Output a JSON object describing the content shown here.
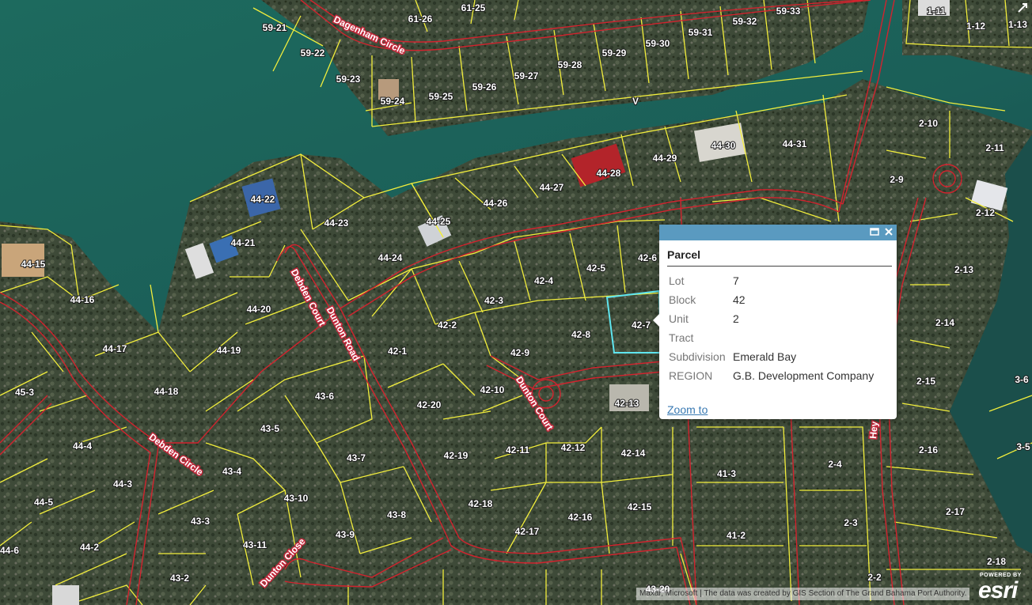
{
  "map": {
    "lots": [
      {
        "id": "61-25"
      },
      {
        "id": "61-26"
      },
      {
        "id": "59-21"
      },
      {
        "id": "59-22"
      },
      {
        "id": "59-23"
      },
      {
        "id": "59-24"
      },
      {
        "id": "59-25"
      },
      {
        "id": "59-26"
      },
      {
        "id": "59-27"
      },
      {
        "id": "59-28"
      },
      {
        "id": "59-29"
      },
      {
        "id": "59-30"
      },
      {
        "id": "59-31"
      },
      {
        "id": "59-32"
      },
      {
        "id": "59-33"
      },
      {
        "id": "1-11"
      },
      {
        "id": "1-12"
      },
      {
        "id": "1-13"
      },
      {
        "id": "44-30"
      },
      {
        "id": "44-31"
      },
      {
        "id": "44-29"
      },
      {
        "id": "44-28"
      },
      {
        "id": "44-27"
      },
      {
        "id": "44-26"
      },
      {
        "id": "44-25"
      },
      {
        "id": "44-24"
      },
      {
        "id": "44-23"
      },
      {
        "id": "44-22"
      },
      {
        "id": "44-21"
      },
      {
        "id": "44-20"
      },
      {
        "id": "44-19"
      },
      {
        "id": "44-18"
      },
      {
        "id": "44-17"
      },
      {
        "id": "44-16"
      },
      {
        "id": "44-15"
      },
      {
        "id": "44-4"
      },
      {
        "id": "44-3"
      },
      {
        "id": "44-5"
      },
      {
        "id": "44-2"
      },
      {
        "id": "44-6"
      },
      {
        "id": "45-3"
      },
      {
        "id": "2-10"
      },
      {
        "id": "2-11"
      },
      {
        "id": "2-9"
      },
      {
        "id": "2-12"
      },
      {
        "id": "2-13"
      },
      {
        "id": "2-14"
      },
      {
        "id": "2-15"
      },
      {
        "id": "2-16"
      },
      {
        "id": "2-4"
      },
      {
        "id": "2-3"
      },
      {
        "id": "2-17"
      },
      {
        "id": "2-18"
      },
      {
        "id": "2-2"
      },
      {
        "id": "3-6"
      },
      {
        "id": "3-5"
      },
      {
        "id": "42-6"
      },
      {
        "id": "42-5"
      },
      {
        "id": "42-4"
      },
      {
        "id": "42-3"
      },
      {
        "id": "42-2"
      },
      {
        "id": "42-1"
      },
      {
        "id": "42-7"
      },
      {
        "id": "42-8"
      },
      {
        "id": "42-9"
      },
      {
        "id": "42-10"
      },
      {
        "id": "42-20"
      },
      {
        "id": "42-13"
      },
      {
        "id": "42-19"
      },
      {
        "id": "42-11"
      },
      {
        "id": "42-12"
      },
      {
        "id": "42-14"
      },
      {
        "id": "42-18"
      },
      {
        "id": "42-17"
      },
      {
        "id": "42-16"
      },
      {
        "id": "42-15"
      },
      {
        "id": "43-6"
      },
      {
        "id": "43-5"
      },
      {
        "id": "43-7"
      },
      {
        "id": "43-4"
      },
      {
        "id": "43-10"
      },
      {
        "id": "43-8"
      },
      {
        "id": "43-3"
      },
      {
        "id": "43-9"
      },
      {
        "id": "43-11"
      },
      {
        "id": "43-2"
      },
      {
        "id": "43-20"
      },
      {
        "id": "41-3"
      },
      {
        "id": "41-2"
      }
    ],
    "streets": [
      {
        "name": "Dagenham Circle"
      },
      {
        "name": "Debden Court"
      },
      {
        "name": "Dunton Road"
      },
      {
        "name": "Dunton Court"
      },
      {
        "name": "Debden Circle"
      },
      {
        "name": "Dunton Close"
      },
      {
        "name": "Hey"
      }
    ],
    "other_labels": [
      "V"
    ],
    "colors": {
      "water": "#1e6b60",
      "parcel_line": "#f2ee3c",
      "road_line": "#d2232e",
      "selected_parcel": "#5fe5ef",
      "popup_header": "#5a9ac0",
      "link": "#3a7ab3"
    }
  },
  "popup": {
    "title": "Parcel",
    "fields": [
      {
        "label": "Lot",
        "value": "7"
      },
      {
        "label": "Block",
        "value": "42"
      },
      {
        "label": "Unit",
        "value": "2"
      },
      {
        "label": "Tract",
        "value": ""
      },
      {
        "label": "Subdivision",
        "value": "Emerald Bay"
      },
      {
        "label": "REGION",
        "value": "G.B. Development Company"
      }
    ],
    "zoom_link": "Zoom to",
    "icons": [
      "maximize-icon",
      "close-icon"
    ]
  },
  "attribution": "Maxar, Microsoft | The data was created by GIS Section of The Grand Bahama Port Authority.",
  "logo": {
    "small": "POWERED BY",
    "big": "esri"
  },
  "toolbar": {
    "icons": [
      "expand-icon"
    ]
  }
}
